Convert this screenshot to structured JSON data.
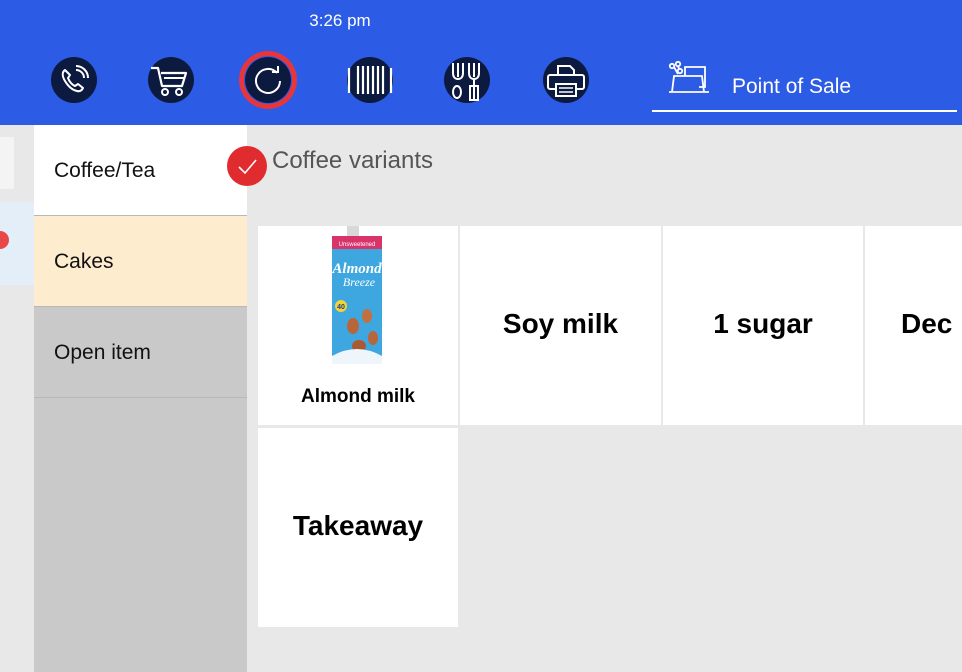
{
  "status_bar": {
    "time": "3:26 pm"
  },
  "toolbar": {
    "accent": "#2c5be6",
    "buttons": [
      {
        "icon": "phone-icon"
      },
      {
        "icon": "cart-icon"
      },
      {
        "icon": "refresh-icon",
        "highlighted": true
      },
      {
        "icon": "barcode-icon"
      },
      {
        "icon": "cutlery-icon"
      },
      {
        "icon": "printer-icon"
      }
    ],
    "mode_label": "Point of Sale",
    "mode_icon": "cash-register-icon"
  },
  "categories": [
    {
      "label": "Coffee/Tea",
      "selected": true
    },
    {
      "label": "Cakes",
      "color": "#feeccf"
    },
    {
      "label": "Open item"
    }
  ],
  "section": {
    "title": "Coffee variants",
    "badge_icon": "check-icon"
  },
  "product_image": {
    "brand": "Almond Breeze",
    "text": [
      "Unsweetened",
      "Almond",
      "Breeze",
      "40"
    ]
  },
  "items": [
    {
      "label": "Almond milk",
      "has_image": true
    },
    {
      "label": "Soy milk"
    },
    {
      "label": "1 sugar"
    },
    {
      "label": "Dec"
    },
    {
      "label": "Takeaway"
    }
  ]
}
